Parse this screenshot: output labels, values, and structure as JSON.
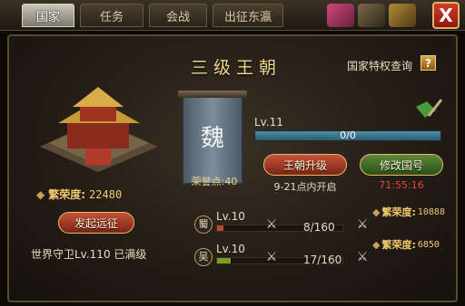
{
  "tabs": [
    {
      "label": "国家",
      "active": true
    },
    {
      "label": "任务",
      "active": false
    },
    {
      "label": "会战",
      "active": false
    },
    {
      "label": "出征东瀛",
      "active": false
    }
  ],
  "close_label": "X",
  "dynasty": {
    "title": "三级王朝"
  },
  "privilege": {
    "label": "国家特权查询",
    "help_label": "?"
  },
  "kingdom": {
    "name": "魏",
    "honor": "荣誉点:40",
    "level": "Lv.11",
    "progress": "0/0",
    "progress_fraction": 0,
    "prosperity_label": "繁荣度:",
    "prosperity_value": "22480"
  },
  "actions": {
    "upgrade_label": "王朝升级",
    "upgrade_note": "9-21点内开启",
    "rename_label": "修改国号",
    "rename_countdown": "71:55:16",
    "expedition_label": "发起远征"
  },
  "guard": {
    "text": "世界守卫Lv.110  已满级"
  },
  "rivals": [
    {
      "name": "蜀",
      "level": "Lv.10",
      "count": "8/160",
      "fraction": 0.05,
      "color": "#b44a2a",
      "prosperity_label": "繁荣度:",
      "prosperity_value": "10888"
    },
    {
      "name": "吴",
      "level": "Lv.10",
      "count": "17/160",
      "fraction": 0.106,
      "color": "#7a9a2a",
      "prosperity_label": "繁荣度:",
      "prosperity_value": "6850"
    }
  ],
  "colors": {
    "gold": "#f2c96a",
    "countdown_red": "#e04a3a",
    "progress_blue": "#4d8fa8"
  }
}
